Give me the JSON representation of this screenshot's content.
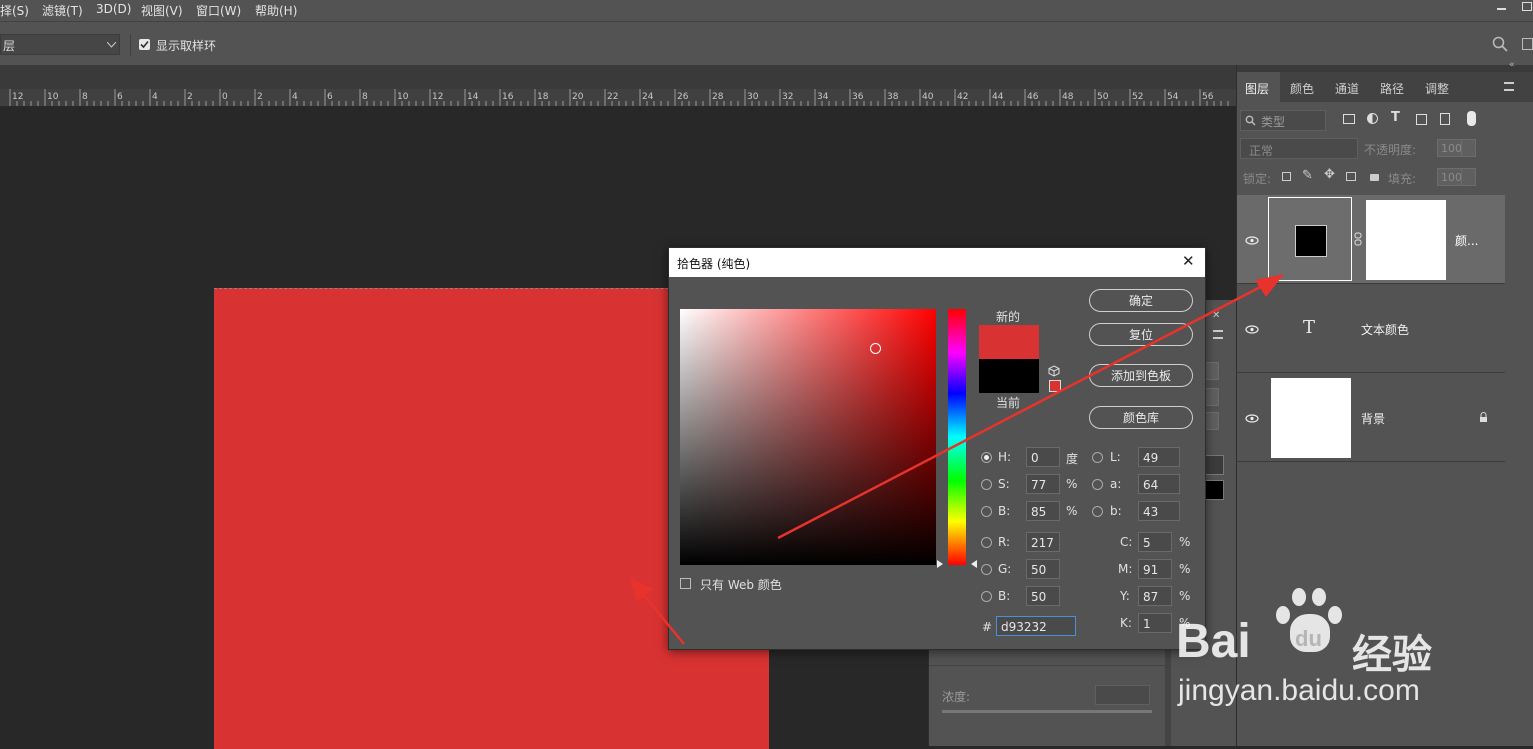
{
  "menu": {
    "items": [
      {
        "label": "择(S)"
      },
      {
        "label": "滤镜(T)"
      },
      {
        "label": "3D(D)"
      },
      {
        "label": "视图(V)"
      },
      {
        "label": "窗口(W)"
      },
      {
        "label": "帮助(H)"
      }
    ]
  },
  "options": {
    "sample_dropdown_value": "层",
    "show_ring_label": "显示取样环",
    "show_ring_checked": true
  },
  "ruler": {
    "ticks": [
      "12",
      "10",
      "8",
      "6",
      "4",
      "2",
      "0",
      "2",
      "4",
      "6",
      "8",
      "10",
      "12",
      "14",
      "16",
      "18",
      "20",
      "22",
      "24",
      "26",
      "28",
      "30",
      "32",
      "34",
      "36",
      "38",
      "40",
      "42",
      "44",
      "46",
      "48",
      "50",
      "52",
      "54",
      "56"
    ]
  },
  "layers_panel": {
    "tabs": [
      "图层",
      "颜色",
      "通道",
      "路径",
      "调整"
    ],
    "filter_placeholder": "类型",
    "blend_mode": "正常",
    "opacity_label": "不透明度:",
    "opacity_value": "100%",
    "lock_label": "锁定:",
    "fill_label": "填充:",
    "fill_value": "100%",
    "layers": [
      {
        "name": "颜...",
        "kind": "fill"
      },
      {
        "name": "文本颜色",
        "kind": "text",
        "glyph": "T"
      },
      {
        "name": "背景",
        "kind": "background"
      }
    ]
  },
  "behind_panel": {
    "density_label": "浓度:"
  },
  "dialog": {
    "title": "拾色器 (纯色)",
    "close_symbol": "✕",
    "new_label": "新的",
    "current_label": "当前",
    "new_color": "#d93232",
    "current_color": "#000000",
    "web_only_label": "只有 Web 颜色",
    "buttons": {
      "ok": "确定",
      "reset": "复位",
      "add_swatch": "添加到色板",
      "color_library": "颜色库"
    },
    "fields": {
      "H": {
        "label": "H:",
        "value": "0",
        "unit": "度",
        "selected": true
      },
      "S": {
        "label": "S:",
        "value": "77",
        "unit": "%"
      },
      "Bv": {
        "label": "B:",
        "value": "85",
        "unit": "%"
      },
      "R": {
        "label": "R:",
        "value": "217"
      },
      "G": {
        "label": "G:",
        "value": "50"
      },
      "Bb": {
        "label": "B:",
        "value": "50"
      },
      "L": {
        "label": "L:",
        "value": "49"
      },
      "a": {
        "label": "a:",
        "value": "64"
      },
      "b": {
        "label": "b:",
        "value": "43"
      },
      "C": {
        "label": "C:",
        "value": "5",
        "unit": "%"
      },
      "M": {
        "label": "M:",
        "value": "91",
        "unit": "%"
      },
      "Y": {
        "label": "Y:",
        "value": "87",
        "unit": "%"
      },
      "K": {
        "label": "K:",
        "value": "1",
        "unit": "%"
      }
    },
    "hex_label": "#",
    "hex_value": "d93232"
  },
  "watermark": {
    "brand": "Bai",
    "brand2": "du",
    "product": "经验",
    "url": "jingyan.baidu.com"
  },
  "colors": {
    "accent_red": "#d93232",
    "arrow_red": "#e8322c",
    "panel_bg": "#535353"
  }
}
